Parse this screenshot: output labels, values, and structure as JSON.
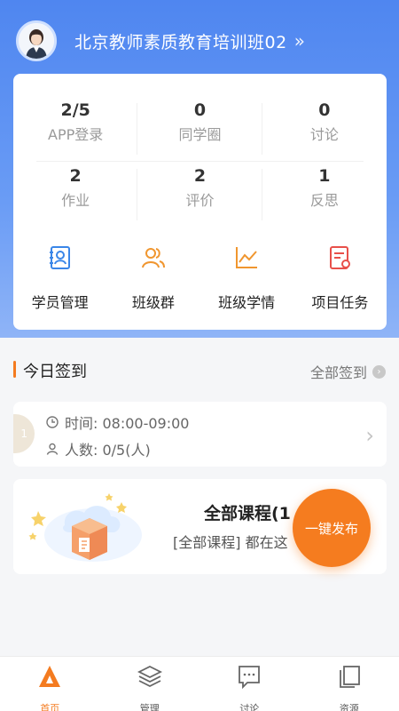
{
  "header": {
    "title": "北京教师素质教育培训班02",
    "chevron": "»"
  },
  "stats": [
    [
      {
        "value": "2/5",
        "label": "APP登录"
      },
      {
        "value": "0",
        "label": "同学圈"
      },
      {
        "value": "0",
        "label": "讨论"
      }
    ],
    [
      {
        "value": "2",
        "label": "作业"
      },
      {
        "value": "2",
        "label": "评价"
      },
      {
        "value": "1",
        "label": "反思"
      }
    ]
  ],
  "quick_actions": [
    {
      "label": "学员管理",
      "icon": "student-manage-icon",
      "color": "#3a86e8"
    },
    {
      "label": "班级群",
      "icon": "class-group-icon",
      "color": "#f0962f"
    },
    {
      "label": "班级学情",
      "icon": "class-stats-icon",
      "color": "#f0962f"
    },
    {
      "label": "项目任务",
      "icon": "project-task-icon",
      "color": "#e8504a"
    }
  ],
  "checkin": {
    "title": "今日签到",
    "all_label": "全部签到",
    "session": {
      "badge": "1",
      "time": "时间: 08:00-09:00",
      "count": "人数: 0/5(人)"
    }
  },
  "course": {
    "title": "全部课程(1",
    "subtitle": "[全部课程] 都在这"
  },
  "fab_label": "一键发布",
  "tabs": [
    {
      "label": "首页",
      "icon": "home-icon",
      "active": true
    },
    {
      "label": "管理",
      "icon": "layers-icon",
      "active": false
    },
    {
      "label": "讨论",
      "icon": "discussion-icon",
      "active": false
    },
    {
      "label": "资源",
      "icon": "resources-icon",
      "active": false
    }
  ],
  "colors": {
    "primary_blue": "#4f86f0",
    "accent_orange": "#f47b20"
  }
}
